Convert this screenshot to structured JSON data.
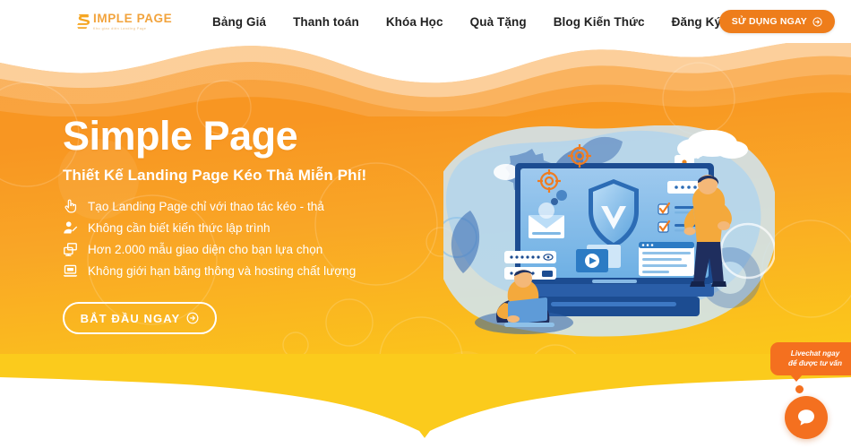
{
  "header": {
    "logo": {
      "main": "IMPLE PAGE",
      "initial": "S",
      "tagline": "Kho giao diện Landing Page"
    },
    "nav_items": [
      {
        "label": "Bảng Giá",
        "name": "nav-item-bang-gia"
      },
      {
        "label": "Thanh toán",
        "name": "nav-item-thanh-toan"
      },
      {
        "label": "Khóa Học",
        "name": "nav-item-khoa-hoc"
      },
      {
        "label": "Quà Tặng",
        "name": "nav-item-qua-tang"
      },
      {
        "label": "Blog Kiến Thức",
        "name": "nav-item-blog-kien-thuc"
      },
      {
        "label": "Đăng Ký Miễn Phí",
        "name": "nav-item-dang-ky-mien-phi"
      }
    ],
    "cta": {
      "label": "SỬ DỤNG NGAY",
      "icon": "arrow-right-circle-icon",
      "bg_color": "#EE7D1B"
    }
  },
  "hero": {
    "title": "Simple Page",
    "subtitle": "Thiết Kế Landing Page Kéo Thả Miễn Phí!",
    "features": [
      {
        "icon": "hand-pointer-icon",
        "text": "Tạo Landing Page chỉ với thao tác kéo - thả"
      },
      {
        "icon": "user-edit-icon",
        "text": "Không cần biết kiến thức lập trình"
      },
      {
        "icon": "copy-screens-icon",
        "text": "Hơn 2.000 mẫu giao diện cho bạn lựa chọn"
      },
      {
        "icon": "laptop-icon",
        "text": "Không giới hạn băng thông và hosting chất lượng"
      }
    ],
    "button": {
      "label": "BẮT ĐẦU NGAY",
      "icon": "arrow-right-circle-icon"
    },
    "gradient_from": "#F79521",
    "gradient_to": "#FCD116",
    "illustration": "web-security-landing-page-illustration"
  },
  "livechat": {
    "line1": "Livechat ngay",
    "line2": "để được tư vấn",
    "icon": "chat-bubble-icon",
    "color": "#F4701F"
  }
}
